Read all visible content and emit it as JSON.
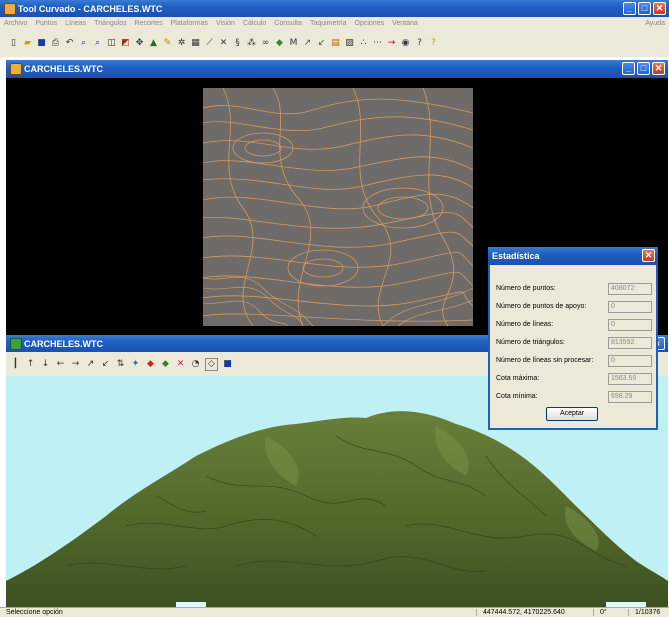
{
  "app": {
    "title": "Tool Curvado - CARCHELES.WTC",
    "menu": [
      "Archivo",
      "Puntos",
      "Líneas",
      "Triángulos",
      "Recortes",
      "Plataformas",
      "Visión",
      "Cálculo",
      "Consulta",
      "Taquimetría",
      "Opciones",
      "Ventana"
    ],
    "help": "Ayuda"
  },
  "contour_window": {
    "title": "CARCHELES.WTC"
  },
  "view3d_window": {
    "title": "CARCHELES.WTC"
  },
  "dialog": {
    "title": "Estadística",
    "rows": [
      {
        "label": "Número de puntos:",
        "value": "408072"
      },
      {
        "label": "Número de puntos de apoyo:",
        "value": "0"
      },
      {
        "label": "Número de líneas:",
        "value": "0"
      },
      {
        "label": "Número de triángulos:",
        "value": "813592"
      },
      {
        "label": "Número de líneas sin procesar:",
        "value": "0"
      },
      {
        "label": "Cota máxima:",
        "value": "1563.59"
      },
      {
        "label": "Cota mínima:",
        "value": "698.29"
      }
    ],
    "ok_label": "Aceptar"
  },
  "status": {
    "message": "Seleccione opción",
    "coords": "447444.572, 4170225.640",
    "angle": "0°",
    "scale": "1/10376"
  },
  "colors": {
    "sky": "#bff0f4",
    "terrain": "#5a6e2c",
    "contour": "#e0a060",
    "contour_bg": "#6e6b68"
  }
}
